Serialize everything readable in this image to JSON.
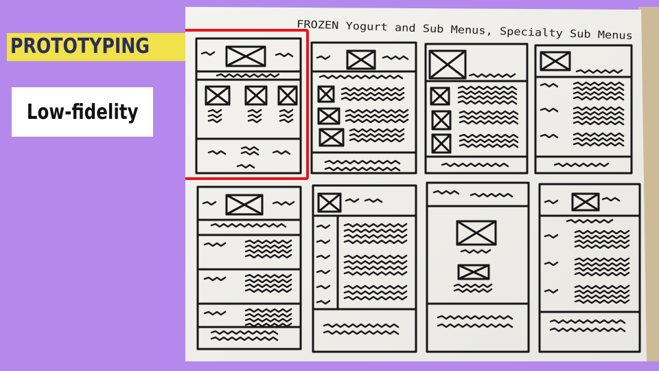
{
  "slide": {
    "title": "PROTOTYPING",
    "subtitle": "Low-fidelity"
  },
  "sketch": {
    "caption": "FROZEN Yogurt and Sub Menus, Specialty Sub Menus",
    "highlight_color": "#e8141c",
    "background_color": "#b488ec",
    "title_bg_color": "#f1e14a"
  }
}
